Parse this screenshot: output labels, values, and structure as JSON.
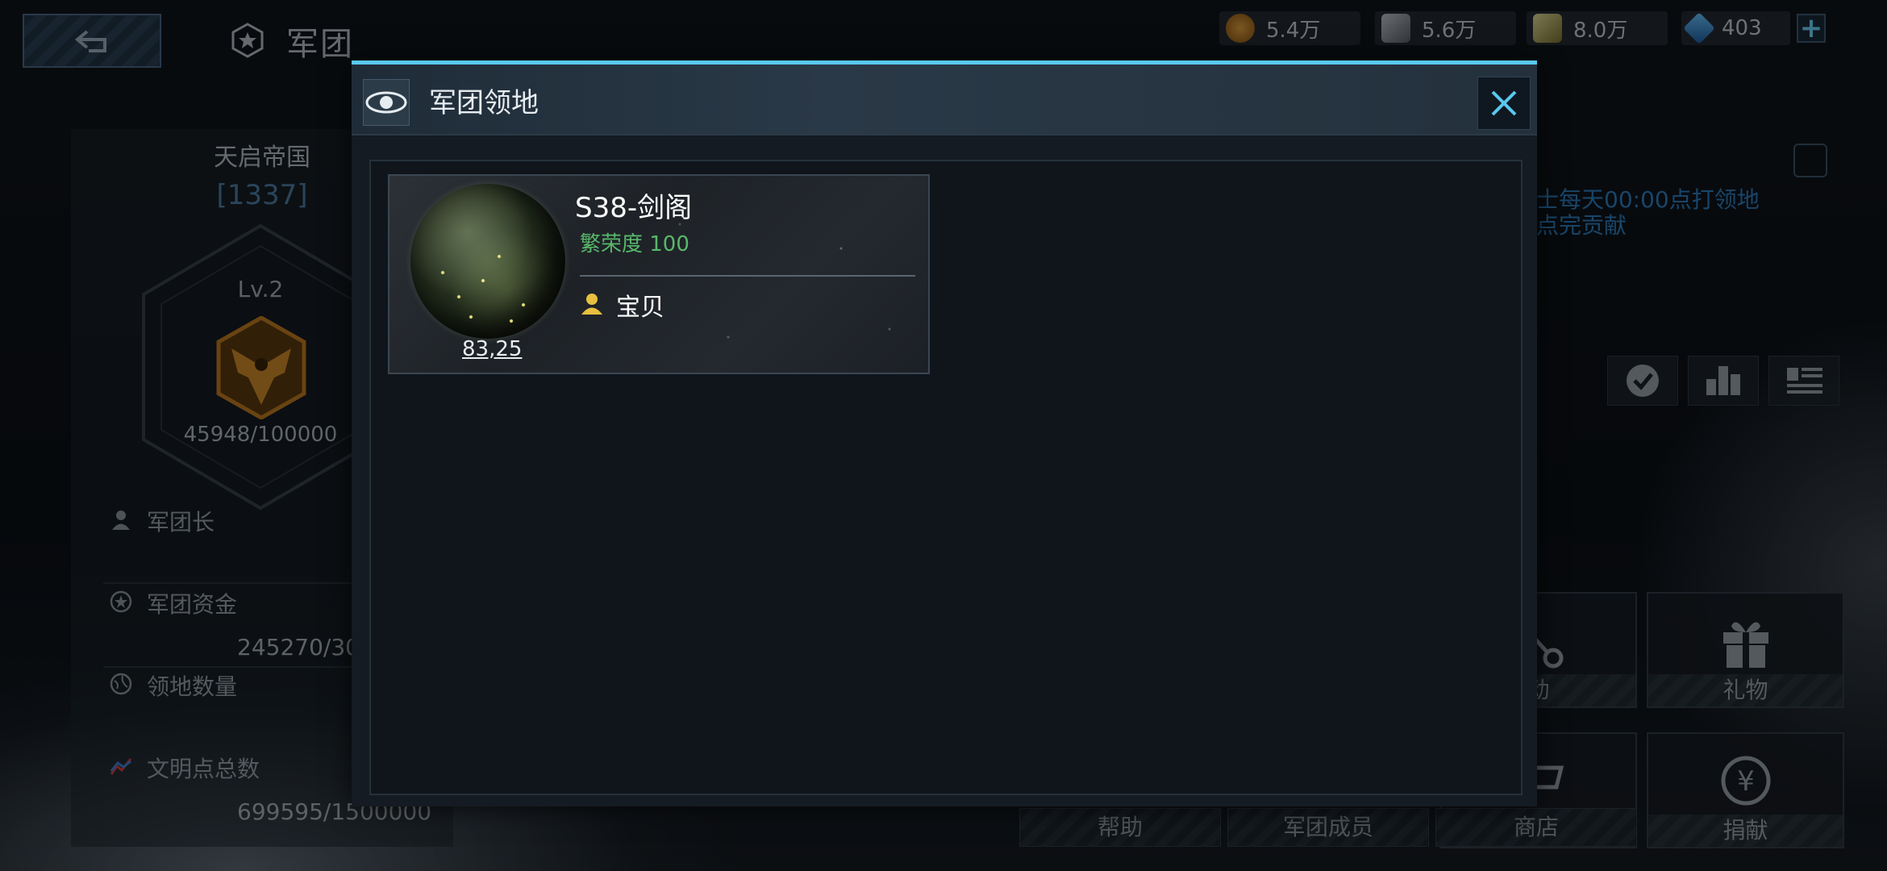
{
  "header": {
    "title": "军团",
    "back_icon": "back-arrow-icon",
    "resources": [
      {
        "name": "coin",
        "value": "5.4万",
        "color": "#d08a2a"
      },
      {
        "name": "alloy",
        "value": "5.6万",
        "color": "#9aa3aa"
      },
      {
        "name": "fuel",
        "value": "8.0万",
        "color": "#c9c07a"
      },
      {
        "name": "diamond",
        "value": "403",
        "color": "#3a9be0"
      }
    ]
  },
  "legion": {
    "name": "天启帝国",
    "id": "[1337]",
    "level": "Lv.2",
    "exp": "45948/100000",
    "leader_label": "军团长",
    "funds_label": "军团资金",
    "funds_value": "245270/30",
    "territory_label": "领地数量",
    "civ_label": "文明点总数",
    "civ_value": "699595/1500000"
  },
  "notice": {
    "line1": "士每天00:00点打领地",
    "line2": "点完贡献"
  },
  "buttons": {
    "activity": "动",
    "gift": "礼物",
    "help": "帮助",
    "members": "军团成员",
    "shop": "商店",
    "donate": "捐献"
  },
  "modal": {
    "title": "军团领地",
    "territory": {
      "name": "S38-剑阁",
      "prosperity": "繁荣度 100",
      "owner": "宝贝",
      "coords": "83,25"
    }
  }
}
